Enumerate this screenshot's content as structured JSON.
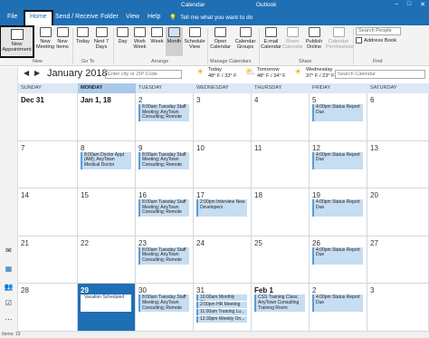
{
  "window": {
    "title_left": "Calendar",
    "title_right": "Outlook",
    "min": "–",
    "max": "□",
    "close": "✕"
  },
  "menu": {
    "tabs": [
      "File",
      "Home",
      "Send / Receive",
      "Folder",
      "View",
      "Help"
    ],
    "tell_me": "Tell me what you want to do"
  },
  "ribbon": {
    "new_appointment": "New Appointment",
    "new_meeting": "New Meeting",
    "new_items": "New Items",
    "today": "Today",
    "next7": "Next 7 Days",
    "day": "Day",
    "work_week": "Work Week",
    "week": "Week",
    "month": "Month",
    "schedule_view": "Schedule View",
    "open_calendar": "Open Calendar",
    "calendar_groups": "Calendar Groups",
    "email_calendar": "E-mail Calendar",
    "share_calendar": "Share Calendar",
    "publish_online": "Publish Online",
    "calendar_permissions": "Calendar Permissions",
    "search_people": "Search People",
    "address_book": "Address Book",
    "groups": {
      "new": "New",
      "goto": "Go To",
      "arrange": "Arrange",
      "manage": "Manage Calendars",
      "share": "Share",
      "find": "Find"
    }
  },
  "calendar": {
    "month_title": "January 2018",
    "city_placeholder": "Enter city or ZIP Code",
    "search_placeholder": "Search Calendar",
    "weather": [
      {
        "label": "Today",
        "temp": "48° F / 33° F"
      },
      {
        "label": "Tomorrow",
        "temp": "48° F / 34° F"
      },
      {
        "label": "Wednesday",
        "temp": "37° F / 23° F"
      }
    ],
    "weekdays": [
      "SUNDAY",
      "MONDAY",
      "TUESDAY",
      "WEDNESDAY",
      "THURSDAY",
      "FRIDAY",
      "SATURDAY"
    ],
    "weeks": [
      {
        "days": [
          "Dec 31",
          "Jan 1, 18",
          "2",
          "3",
          "4",
          "5",
          "6"
        ],
        "events": [
          {
            "day": 2,
            "text": "8:00am Tuesday Staff Meeting; AnyTown Consulting; Remote"
          },
          {
            "day": 5,
            "text": "4:00pm Status Report Due"
          }
        ]
      },
      {
        "days": [
          "7",
          "8",
          "9",
          "10",
          "11",
          "12",
          "13"
        ],
        "events": [
          {
            "day": 1,
            "text": "8:00am Doctor Appt (AM); AnyTown Medical Doctor"
          },
          {
            "day": 2,
            "text": "8:00am Tuesday Staff Meeting; AnyTown Consulting; Remote"
          },
          {
            "day": 5,
            "text": "4:00pm Status Report Due"
          }
        ]
      },
      {
        "days": [
          "14",
          "15",
          "16",
          "17",
          "18",
          "19",
          "20"
        ],
        "events": [
          {
            "day": 2,
            "text": "8:00am Tuesday Staff Meeting; AnyTown Consulting; Remote"
          },
          {
            "day": 3,
            "text": "2:00pm Interview New Developers"
          },
          {
            "day": 5,
            "text": "4:00pm Status Report Due"
          }
        ]
      },
      {
        "days": [
          "21",
          "22",
          "23",
          "24",
          "25",
          "26",
          "27"
        ],
        "events": [
          {
            "day": 2,
            "text": "8:00am Tuesday Staff Meeting; AnyTown Consulting; Remote"
          },
          {
            "day": 5,
            "text": "4:00pm Status Report Due"
          }
        ]
      },
      {
        "days": [
          "28",
          "29",
          "30",
          "31",
          "Feb 1",
          "2",
          "3"
        ],
        "events": [
          {
            "day": 1,
            "text": "Vacation Scheduled"
          },
          {
            "day": 2,
            "text": "8:00am Tuesday Staff Meeting; AnyTown Consulting; Remote"
          },
          {
            "day": 3,
            "text": "10:00am Monthly Clie..."
          },
          {
            "day": 3,
            "text": "2:00pm HR Meeting"
          },
          {
            "day": 3,
            "text": "11:00am Training Lu..."
          },
          {
            "day": 3,
            "text": "12:30pm Weekly On..."
          },
          {
            "day": 4,
            "text": "CSS Training Class; AnyTown Consulting Training Room"
          },
          {
            "day": 5,
            "text": "4:00pm Status Report Due"
          }
        ]
      }
    ]
  },
  "status": {
    "items": "Items: 19"
  },
  "colors": {
    "accent": "#1f6fb5",
    "event": "#c6ddf2",
    "header": "#dbe8f5"
  }
}
